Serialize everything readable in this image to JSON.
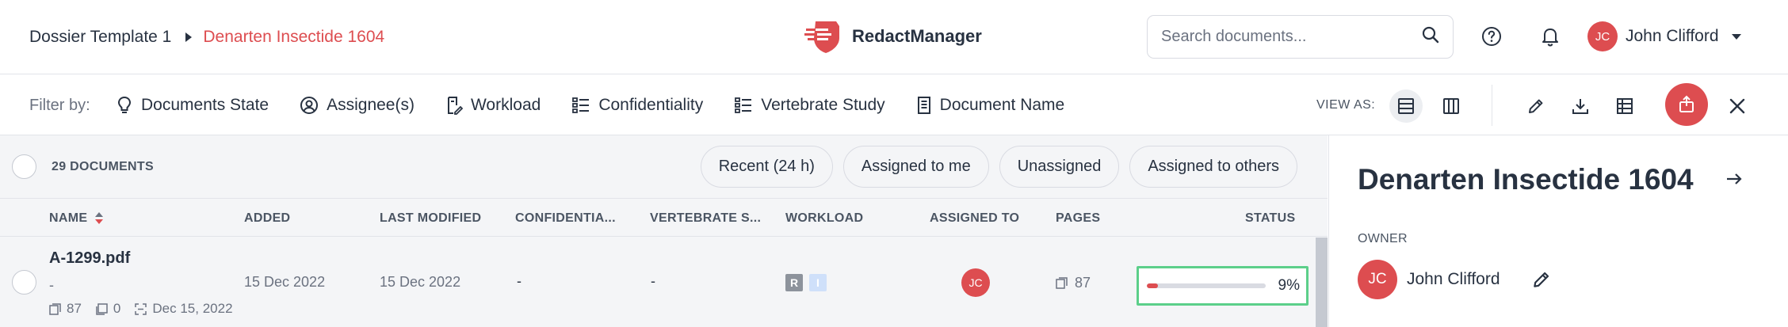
{
  "breadcrumb": {
    "root": "Dossier Template 1",
    "current": "Denarten Insectide 1604"
  },
  "brand": {
    "name": "RedactManager",
    "color": "#dd4d50"
  },
  "search": {
    "placeholder": "Search documents...",
    "value": ""
  },
  "header_icons": [
    "help-icon",
    "bell-icon"
  ],
  "user": {
    "initials": "JC",
    "name": "John Clifford"
  },
  "filterbar": {
    "label": "Filter by:",
    "filters": [
      {
        "label": "Documents State",
        "icon": "lightbulb-icon"
      },
      {
        "label": "Assignee(s)",
        "icon": "user-circle-icon"
      },
      {
        "label": "Workload",
        "icon": "document-pen-icon"
      },
      {
        "label": "Confidentiality",
        "icon": "list-icon"
      },
      {
        "label": "Vertebrate Study",
        "icon": "list-icon"
      },
      {
        "label": "Document Name",
        "icon": "document-icon"
      }
    ],
    "view_as_label": "VIEW AS:",
    "view_modes": [
      "list-view-icon",
      "columns-view-icon"
    ],
    "actions": [
      "edit-icon",
      "download-icon",
      "table-icon",
      "upload-icon",
      "close-icon"
    ]
  },
  "list": {
    "count_label": "29 DOCUMENTS",
    "quick_filters": [
      "Recent (24 h)",
      "Assigned to me",
      "Unassigned",
      "Assigned to others"
    ],
    "columns": {
      "name": "NAME",
      "added": "ADDED",
      "last_modified": "LAST MODIFIED",
      "confidentiality": "CONFIDENTIA...",
      "vertebrate": "VERTEBRATE S...",
      "workload": "WORKLOAD",
      "assigned_to": "ASSIGNED TO",
      "pages": "PAGES",
      "status": "STATUS"
    },
    "rows": [
      {
        "name": "A-1299.pdf",
        "subtitle": "-",
        "meta_pages": "87",
        "meta_annotations": "0",
        "meta_date": "Dec 15, 2022",
        "added": "15 Dec 2022",
        "last_modified": "15 Dec 2022",
        "confidentiality": "-",
        "vertebrate": "-",
        "workload_badges": [
          "R",
          "I"
        ],
        "assignee_initials": "JC",
        "pages": "87",
        "progress_percent": 9,
        "progress_label": "9%"
      }
    ]
  },
  "details": {
    "title": "Denarten Insectide 1604",
    "owner_label": "OWNER",
    "owner_initials": "JC",
    "owner_name": "John Clifford"
  }
}
